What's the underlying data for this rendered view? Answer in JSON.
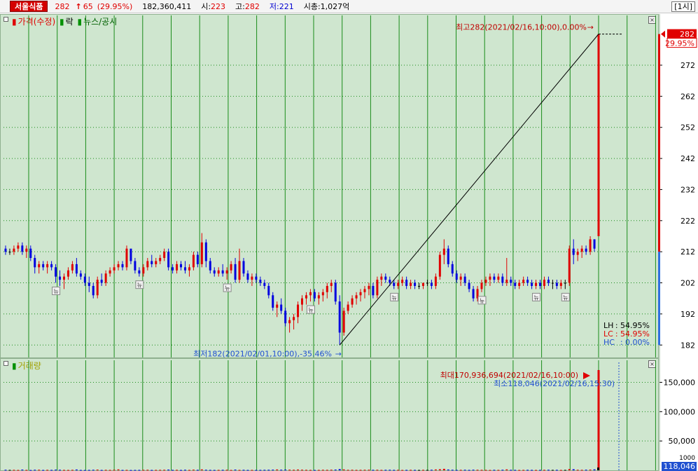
{
  "header": {
    "stock_name": "서울식품",
    "price": "282",
    "arrow": "↑",
    "change": "65",
    "change_pct": "(29.95%)",
    "volume": "182,360,411",
    "open_label": "시:",
    "open": "223",
    "high_label": "고:",
    "high": "282",
    "low_label": "저:",
    "low": "221",
    "mcap_label": "시총:",
    "mcap": "1,027억",
    "interval": "[1시]"
  },
  "legend": {
    "price": "가격(수정)",
    "down": "락",
    "news": "뉴스/공시",
    "volume": "거래량"
  },
  "colors": {
    "background": "#cfe6cf",
    "up": "#e00000",
    "down": "#0000e0",
    "grid": "#1a8c1a"
  },
  "stats": {
    "lh_label": "LH",
    "lh": ": 54.95%",
    "lc_label": "LC",
    "lc": ": 54.95%",
    "hc_label": "HC",
    "hc": ":  0.00%"
  },
  "icon_news": "뉴",
  "chart_data": [
    {
      "type": "candlestick",
      "series_name": "가격(수정)",
      "ylim": [
        178,
        288
      ],
      "yticks": [
        182,
        192,
        202,
        212,
        222,
        232,
        242,
        252,
        262,
        272
      ],
      "current_label": "282",
      "current_pct": "29.95%",
      "annotation_high": "최고282(2021/02/16,10:00),0.00%",
      "annotation_low": "최저182(2021/02/01,10:00),-35.46%",
      "high_index": 142,
      "low_index": 80,
      "news_indices": [
        12,
        32,
        53,
        73,
        93,
        114,
        127,
        134
      ],
      "candles": [
        [
          213,
          214,
          211,
          212
        ],
        [
          212,
          213,
          211,
          212
        ],
        [
          212,
          214,
          211,
          213
        ],
        [
          213,
          215,
          212,
          214
        ],
        [
          214,
          215,
          211,
          212
        ],
        [
          212,
          214,
          210,
          213
        ],
        [
          213,
          214,
          209,
          210
        ],
        [
          210,
          211,
          205,
          207
        ],
        [
          207,
          209,
          205,
          208
        ],
        [
          208,
          209,
          206,
          207
        ],
        [
          207,
          209,
          205,
          208
        ],
        [
          208,
          209,
          206,
          207
        ],
        [
          207,
          208,
          202,
          204
        ],
        [
          204,
          206,
          201,
          203
        ],
        [
          203,
          205,
          200,
          204
        ],
        [
          204,
          207,
          203,
          206
        ],
        [
          206,
          209,
          205,
          208
        ],
        [
          208,
          210,
          204,
          205
        ],
        [
          205,
          206,
          203,
          204
        ],
        [
          204,
          205,
          201,
          202
        ],
        [
          202,
          204,
          199,
          201
        ],
        [
          201,
          202,
          197,
          198
        ],
        [
          198,
          204,
          197,
          203
        ],
        [
          203,
          205,
          201,
          202
        ],
        [
          202,
          206,
          201,
          205
        ],
        [
          205,
          207,
          204,
          206
        ],
        [
          206,
          208,
          205,
          207
        ],
        [
          207,
          209,
          206,
          208
        ],
        [
          208,
          209,
          206,
          207
        ],
        [
          207,
          214,
          206,
          213
        ],
        [
          213,
          212,
          208,
          209
        ],
        [
          209,
          210,
          205,
          206
        ],
        [
          206,
          207,
          204,
          205
        ],
        [
          205,
          208,
          204,
          207
        ],
        [
          207,
          210,
          206,
          209
        ],
        [
          209,
          211,
          207,
          208
        ],
        [
          208,
          210,
          207,
          209
        ],
        [
          209,
          211,
          208,
          210
        ],
        [
          210,
          213,
          209,
          212
        ],
        [
          212,
          213,
          206,
          207
        ],
        [
          207,
          208,
          205,
          206
        ],
        [
          206,
          209,
          205,
          208
        ],
        [
          208,
          209,
          206,
          207
        ],
        [
          207,
          209,
          205,
          206
        ],
        [
          206,
          208,
          204,
          207
        ],
        [
          207,
          212,
          206,
          211
        ],
        [
          211,
          212,
          207,
          208
        ],
        [
          208,
          218,
          207,
          215
        ],
        [
          215,
          216,
          207,
          209
        ],
        [
          209,
          210,
          205,
          206
        ],
        [
          206,
          207,
          204,
          205
        ],
        [
          205,
          207,
          204,
          206
        ],
        [
          206,
          208,
          204,
          205
        ],
        [
          205,
          207,
          203,
          206
        ],
        [
          206,
          209,
          205,
          208
        ],
        [
          208,
          210,
          202,
          203
        ],
        [
          203,
          213,
          202,
          209
        ],
        [
          209,
          210,
          204,
          205
        ],
        [
          205,
          206,
          202,
          203
        ],
        [
          203,
          205,
          201,
          204
        ],
        [
          204,
          205,
          202,
          203
        ],
        [
          203,
          204,
          201,
          202
        ],
        [
          202,
          203,
          200,
          201
        ],
        [
          201,
          202,
          197,
          198
        ],
        [
          198,
          199,
          193,
          194
        ],
        [
          194,
          196,
          191,
          195
        ],
        [
          195,
          197,
          192,
          193
        ],
        [
          193,
          194,
          188,
          189
        ],
        [
          189,
          191,
          186,
          190
        ],
        [
          190,
          192,
          187,
          191
        ],
        [
          191,
          196,
          189,
          195
        ],
        [
          195,
          198,
          193,
          197
        ],
        [
          197,
          199,
          195,
          198
        ],
        [
          198,
          200,
          196,
          199
        ],
        [
          199,
          200,
          196,
          197
        ],
        [
          197,
          199,
          195,
          198
        ],
        [
          198,
          200,
          196,
          199
        ],
        [
          199,
          202,
          197,
          201
        ],
        [
          201,
          203,
          199,
          202
        ],
        [
          202,
          203,
          195,
          196
        ],
        [
          196,
          198,
          182,
          186
        ],
        [
          186,
          194,
          185,
          193
        ],
        [
          193,
          196,
          192,
          195
        ],
        [
          195,
          198,
          194,
          197
        ],
        [
          197,
          199,
          195,
          198
        ],
        [
          198,
          200,
          196,
          199
        ],
        [
          199,
          201,
          197,
          200
        ],
        [
          200,
          202,
          198,
          201
        ],
        [
          201,
          202,
          197,
          198
        ],
        [
          198,
          204,
          197,
          203
        ],
        [
          203,
          205,
          201,
          204
        ],
        [
          204,
          205,
          202,
          203
        ],
        [
          203,
          204,
          201,
          202
        ],
        [
          202,
          203,
          200,
          201
        ],
        [
          201,
          203,
          200,
          202
        ],
        [
          202,
          204,
          201,
          203
        ],
        [
          203,
          204,
          200,
          201
        ],
        [
          201,
          203,
          200,
          202
        ],
        [
          202,
          203,
          200,
          201
        ],
        [
          201,
          202,
          200,
          201
        ],
        [
          201,
          202,
          200,
          202
        ],
        [
          202,
          203,
          201,
          202
        ],
        [
          202,
          203,
          200,
          201
        ],
        [
          201,
          205,
          200,
          204
        ],
        [
          204,
          212,
          203,
          211
        ],
        [
          211,
          216,
          208,
          213
        ],
        [
          213,
          214,
          207,
          208
        ],
        [
          208,
          209,
          204,
          205
        ],
        [
          205,
          206,
          202,
          203
        ],
        [
          203,
          205,
          201,
          204
        ],
        [
          204,
          205,
          201,
          202
        ],
        [
          202,
          203,
          199,
          200
        ],
        [
          200,
          201,
          196,
          197
        ],
        [
          197,
          201,
          196,
          200
        ],
        [
          200,
          203,
          199,
          202
        ],
        [
          202,
          204,
          201,
          203
        ],
        [
          203,
          205,
          201,
          204
        ],
        [
          204,
          205,
          202,
          203
        ],
        [
          203,
          205,
          202,
          204
        ],
        [
          204,
          205,
          201,
          202
        ],
        [
          202,
          210,
          201,
          203
        ],
        [
          203,
          204,
          201,
          202
        ],
        [
          202,
          203,
          200,
          201
        ],
        [
          201,
          203,
          200,
          202
        ],
        [
          202,
          204,
          201,
          203
        ],
        [
          203,
          204,
          201,
          202
        ],
        [
          202,
          203,
          200,
          201
        ],
        [
          201,
          203,
          200,
          202
        ],
        [
          202,
          203,
          200,
          201
        ],
        [
          201,
          204,
          200,
          203
        ],
        [
          203,
          204,
          201,
          202
        ],
        [
          202,
          203,
          200,
          202
        ],
        [
          202,
          203,
          200,
          201
        ],
        [
          201,
          203,
          200,
          202
        ],
        [
          202,
          203,
          200,
          202
        ],
        [
          202,
          214,
          201,
          213
        ],
        [
          213,
          216,
          208,
          211
        ],
        [
          211,
          213,
          209,
          212
        ],
        [
          212,
          214,
          210,
          213
        ],
        [
          213,
          214,
          211,
          212
        ],
        [
          212,
          217,
          211,
          216
        ],
        [
          216,
          216,
          212,
          213
        ],
        [
          217,
          282,
          221,
          282
        ]
      ]
    },
    {
      "type": "bar",
      "series_name": "거래량",
      "ylim": [
        0,
        190000
      ],
      "yticks": [
        50000,
        100000,
        150000
      ],
      "ytick_labels": [
        "50,000",
        "100,000",
        "150,000"
      ],
      "current_label": "118,046",
      "partial_label": "1000",
      "annotation_max": "최대170,936,694(2021/02/16,10:00)",
      "annotation_min": "최소118,046(2021/02/16,15:30)",
      "values": [
        900,
        700,
        800,
        600,
        1200,
        700,
        500,
        900,
        1000,
        600,
        800,
        700,
        1100,
        900,
        700,
        600,
        800,
        1300,
        600,
        500,
        700,
        900,
        1200,
        600,
        800,
        700,
        900,
        1500,
        600,
        700,
        500,
        600,
        700,
        800,
        900,
        600,
        700,
        800,
        900,
        1200,
        700,
        800,
        600,
        900,
        700,
        1100,
        800,
        1500,
        900,
        700,
        600,
        700,
        800,
        900,
        600,
        1200,
        700,
        800,
        600,
        700,
        600,
        700,
        800,
        900,
        1100,
        1400,
        1000,
        1200,
        1100,
        900,
        1300,
        1000,
        800,
        700,
        600,
        700,
        900,
        800,
        1000,
        1200,
        2000,
        1500,
        800,
        900,
        700,
        800,
        900,
        1000,
        800,
        900,
        700,
        800,
        900,
        700,
        800,
        600,
        700,
        800,
        700,
        600,
        800,
        700,
        900,
        1400,
        1800,
        2500,
        1300,
        900,
        700,
        800,
        900,
        700,
        1000,
        900,
        800,
        700,
        600,
        800,
        700,
        900,
        1500,
        800,
        700,
        600,
        700,
        800,
        700,
        600,
        700,
        800,
        900,
        700,
        800,
        600,
        700,
        2000,
        1800,
        900,
        800,
        1000,
        1200,
        1500,
        170936
      ]
    }
  ]
}
